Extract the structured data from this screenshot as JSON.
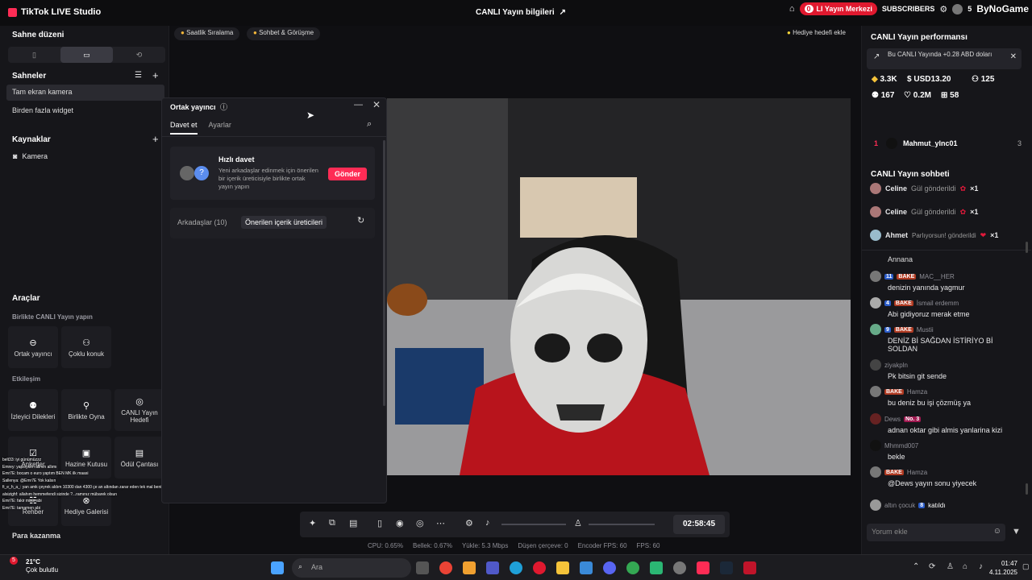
{
  "topbar": {
    "app_title": "TikTok LIVE Studio",
    "center_title": "CANLI Yayın bilgileri",
    "live_center": "LI Yayın Merkezi",
    "live_center_count": "0",
    "subscribers": "SUBSCRIBERS",
    "sub_count": "5",
    "brand": "ByNoGame"
  },
  "left": {
    "scene_layout": "Sahne düzeni",
    "scenes_title": "Sahneler",
    "scenes": [
      "Tam ekran kamera",
      "Birden fazla widget"
    ],
    "sources_title": "Kaynaklar",
    "sources": [
      "Kamera"
    ],
    "tools_title": "Araçlar",
    "together_title": "Birlikte CANLI Yayın yapın",
    "together_tools": [
      "Ortak yayıncı",
      "Çoklu konuk"
    ],
    "interaction_title": "Etkileşim",
    "interaction_tools": [
      "İzleyici Dilekleri",
      "Birlikte Oyna",
      "CANLI Yayın Hedefi"
    ],
    "more_tools": [
      "Anketler",
      "Hazine Kutusu",
      "Ödül Çantası"
    ],
    "more_tools2": [
      "Rehber",
      "Hediye Galerisi"
    ],
    "earn_title": "Para kazanma"
  },
  "stage": {
    "chip_hourly": "Saatlik Sıralama",
    "chip_chat": "Sohbet & Görüşme",
    "gift_goal": "Hediye hedefi ekle"
  },
  "cohost": {
    "title": "Ortak yayıncı",
    "tab_invite": "Davet et",
    "tab_settings": "Ayarlar",
    "quick_title": "Hızlı davet",
    "quick_desc": "Yeni arkadaşlar edinmek için önerilen bir içerik üreticisiyle birlikte ortak yayın yapın",
    "send": "Gönder",
    "friends": "Arkadaşlar (10)",
    "suggested": "Önerilen içerik üreticileri"
  },
  "controls": {
    "timer": "02:58:45"
  },
  "stats": {
    "cpu": "CPU: 0.65%",
    "memory": "Bellek: 0.67%",
    "upload": "Yükle: 5.3 Mbps",
    "dropped": "Düşen çerçeve: 0",
    "encoder_fps": "Encoder FPS: 60",
    "fps": "FPS: 60"
  },
  "right": {
    "perf_title": "CANLI Yayın performansı",
    "earn_note": "Bu CANLI Yayında +0.28 ABD doları",
    "diamonds": "3.3K",
    "usd": "USD13.20",
    "viewers": "125",
    "new_followers": "167",
    "likes": "0.2M",
    "gifters": "58",
    "rank_num": "1",
    "rank_name": "Mahmut_ylnc01",
    "rank_val": "3",
    "chat_title": "CANLI Yayın sohbeti",
    "gifts": [
      {
        "user": "Celine",
        "text": "Gül gönderildi",
        "count": "×1"
      },
      {
        "user": "Celine",
        "text": "Gül gönderildi",
        "count": "×1"
      },
      {
        "user": "Ahmet",
        "text": "Parlıyorsun! gönderildi",
        "count": "×1"
      }
    ],
    "partial_top": "Annana",
    "messages": [
      {
        "lvl": "11",
        "tag": "BAKE",
        "user": "MAC__HER",
        "text": "denizin yanında yagmur"
      },
      {
        "lvl": "4",
        "tag": "BAKE",
        "user": "İsmail erdemm",
        "text": "Abi gidiyoruz merak etme"
      },
      {
        "lvl": "9",
        "tag": "BAKE",
        "user": "Mustii",
        "text": "DENİZ Bİ SAĞDAN İSTİRİYO Bİ SOLDAN"
      },
      {
        "lvl": "",
        "tag": "",
        "user": "ziyakpln",
        "text": "Pk bitsin git sende"
      },
      {
        "lvl": "",
        "tag": "BAKE",
        "user": "Hamza",
        "text": "bu deniz bu işi çözmüş ya"
      },
      {
        "lvl": "",
        "tag": "No. 3",
        "user": "Dews",
        "text": "adnan oktar gibi almis yanlarina kizi"
      },
      {
        "lvl": "",
        "tag": "",
        "user": "Mhmmd007",
        "text": "bekle"
      },
      {
        "lvl": "",
        "tag": "BAKE",
        "user": "Hamza",
        "text": "@Dews yayın sonu yiyecek"
      }
    ],
    "join_user": "altın çocuk",
    "join_lvl": "8",
    "join_text": "katıldı",
    "comment_placeholder": "Yorum ekle"
  },
  "taskbar": {
    "temp": "21°C",
    "weather": "Çok bulutlu",
    "weather_badge": "5",
    "search": "Ara",
    "time": "01:47",
    "date": "4.11.2025"
  },
  "overlay_chat": [
    "belt33: iyi günümüzzz",
    "Emrey: yapsıyken allmin allımı",
    "Emr7E: bocam o euro yaptım BEN MK ilk maasi",
    "Sallenya: @Emr7E Yok kalsın",
    "fi_e_h_a_: yan amk çeyrek aldım 10300 dan 4300 çe an altından zarar eden tek mal benim amk",
    "alsizighf: allahım hemmefendi sizinde ?...ramınız mübarek olsun",
    "Emr7E: fakir misin abi",
    "Emr7E: tamamen abi"
  ],
  "colors": {
    "accent": "#fe2c55",
    "panel": "#16161a",
    "badge_blue": "#2b5cc8",
    "badge_bake": "#b03a22"
  }
}
